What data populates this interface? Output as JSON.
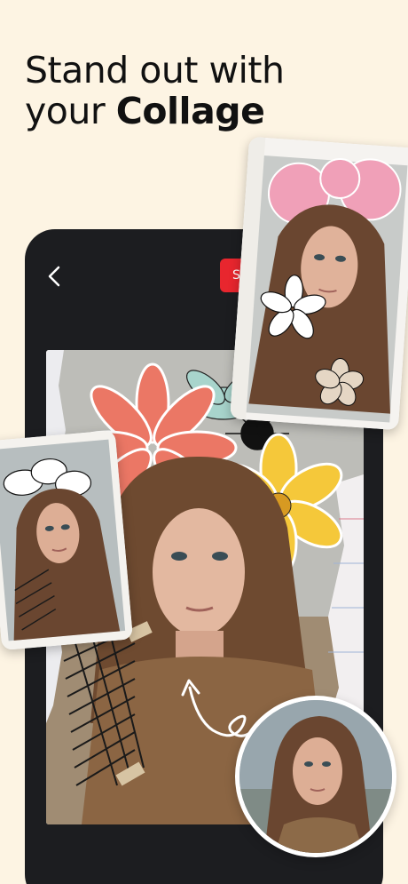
{
  "headline": {
    "line1": "Stand out with",
    "line2_plain": "your ",
    "line2_bold": "Collage"
  },
  "toolbar": {
    "back_icon": "chevron-left-icon",
    "save_label": "Save"
  },
  "colors": {
    "background": "#FDF4E3",
    "phone": "#1C1D20",
    "save_button": "#E8262E",
    "flower_pink": "#EB7765",
    "flower_yellow": "#F5C83A",
    "flower_teal": "#A8D4CC"
  }
}
